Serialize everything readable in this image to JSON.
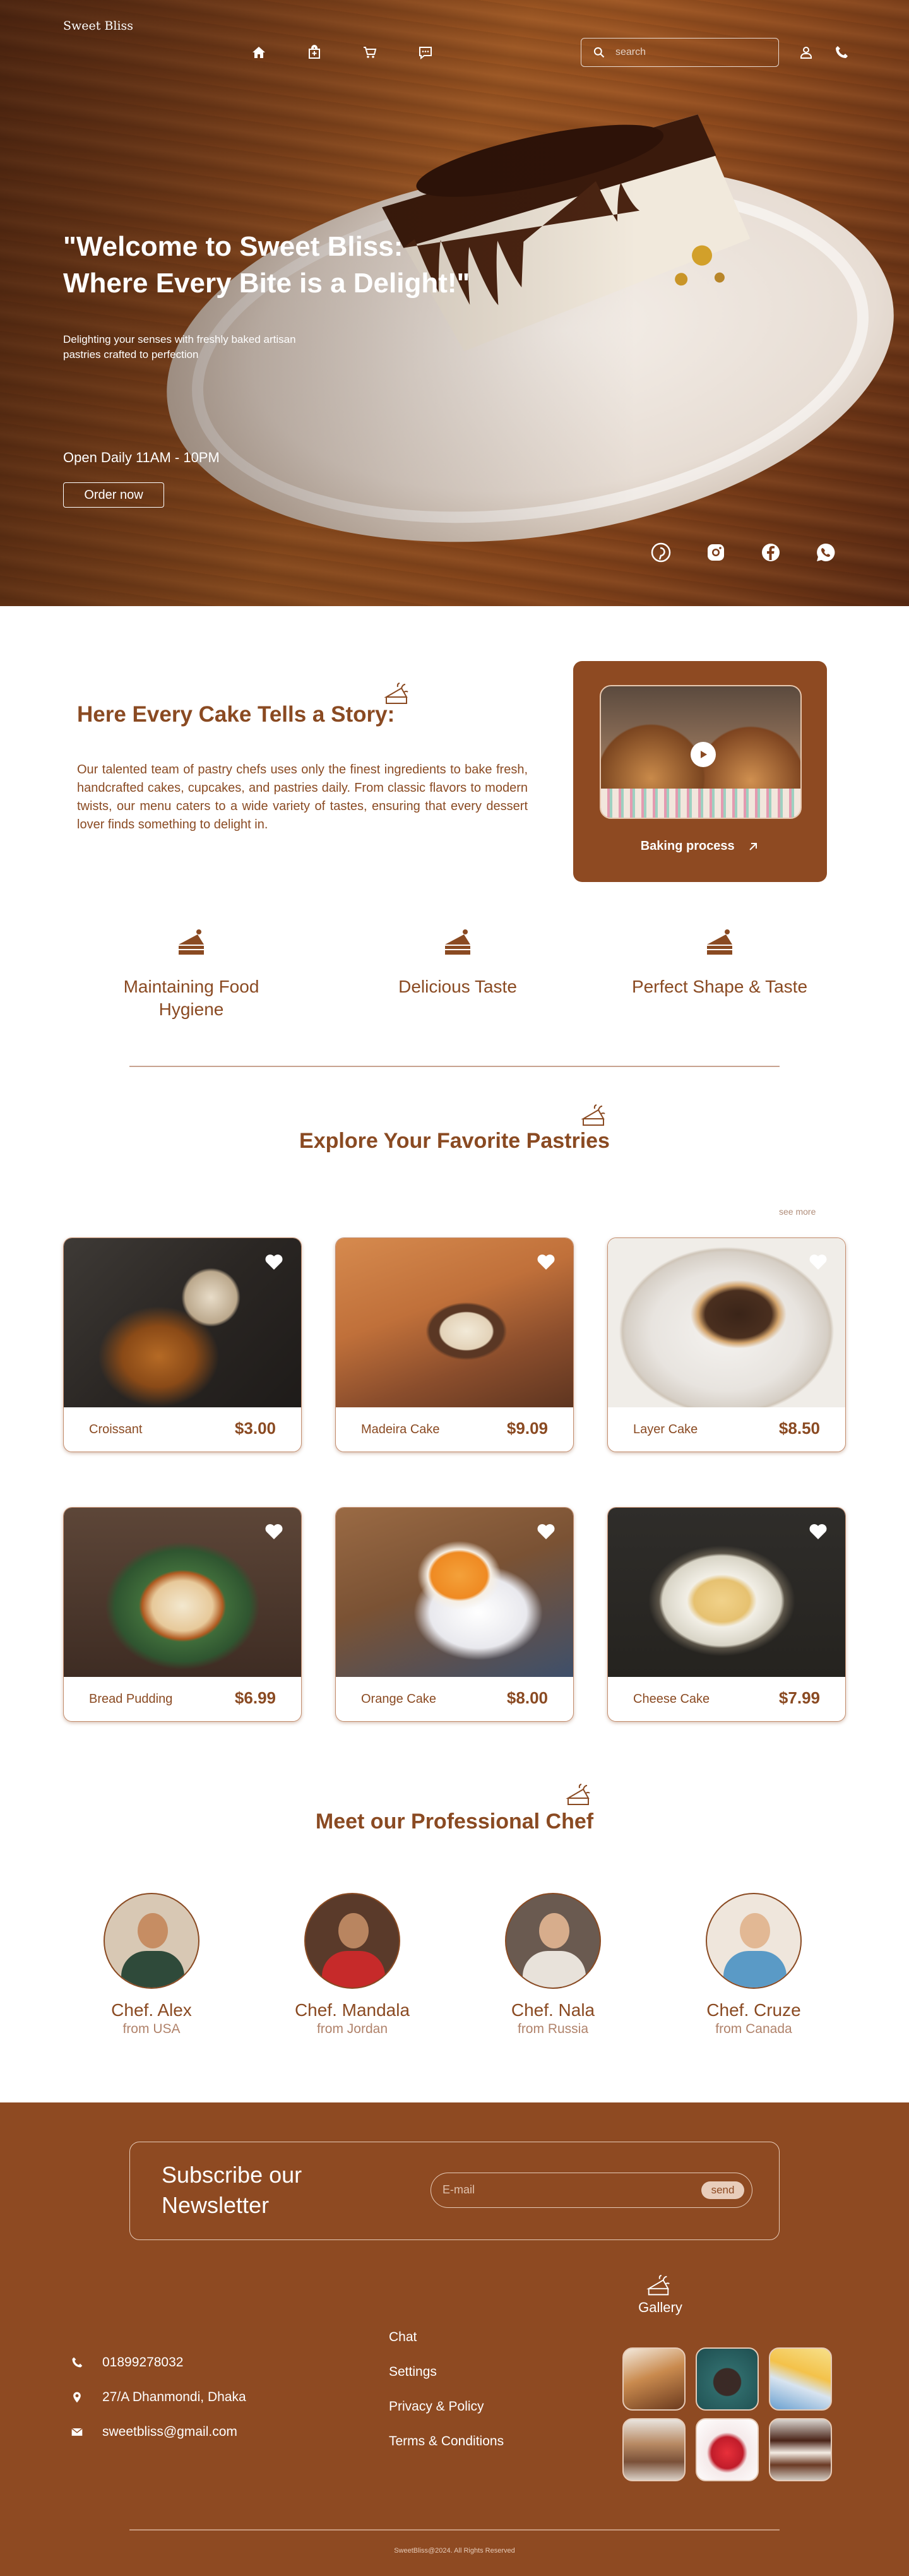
{
  "nav": {
    "logo": "Sweet Bliss",
    "icons": [
      "home-icon",
      "shopping-bag-icon",
      "cart-icon",
      "chat-icon"
    ],
    "search_placeholder": "search",
    "right_icons": [
      "user-icon",
      "phone-icon"
    ]
  },
  "hero": {
    "title_line1": "\"Welcome to Sweet Bliss:",
    "title_line2": "Where Every Bite is a Delight!\"",
    "subtitle": "Delighting your senses with freshly baked artisan pastries crafted to perfection",
    "hours": "Open Daily 11AM - 10PM",
    "order_button": "Order now",
    "socials": [
      "pinterest-icon",
      "instagram-icon",
      "facebook-icon",
      "whatsapp-icon"
    ]
  },
  "story": {
    "title": "Here Every Cake Tells a Story:",
    "text": "Our talented team of pastry chefs uses only the finest ingredients to bake fresh, handcrafted cakes, cupcakes, and pastries daily. From classic flavors to modern twists, our menu caters to a wide variety of tastes, ensuring that every dessert lover finds something to delight in.",
    "video_label": "Baking process"
  },
  "features": [
    {
      "label": "Maintaining Food Hygiene"
    },
    {
      "label": "Delicious Taste"
    },
    {
      "label": "Perfect Shape & Taste"
    }
  ],
  "pastries": {
    "title": "Explore Your Favorite Pastries",
    "see_more": "see more",
    "items": [
      {
        "name": "Croissant",
        "price": "$3.00"
      },
      {
        "name": "Madeira Cake",
        "price": "$9.09"
      },
      {
        "name": "Layer Cake",
        "price": "$8.50"
      },
      {
        "name": "Bread Pudding",
        "price": "$6.99"
      },
      {
        "name": "Orange Cake",
        "price": "$8.00"
      },
      {
        "name": "Cheese Cake",
        "price": "$7.99"
      }
    ]
  },
  "chefs": {
    "title": "Meet our Professional Chef",
    "items": [
      {
        "name": "Chef. Alex",
        "from": "from USA"
      },
      {
        "name": "Chef. Mandala",
        "from": "from Jordan"
      },
      {
        "name": "Chef. Nala",
        "from": "from Russia"
      },
      {
        "name": "Chef. Cruze",
        "from": "from Canada"
      }
    ]
  },
  "footer": {
    "newsletter_title": "Subscribe our Newsletter",
    "email_placeholder": "E-mail",
    "send_label": "send",
    "phone": "01899278032",
    "address": "27/A Dhanmondi, Dhaka",
    "email": "sweetbliss@gmail.com",
    "links": [
      "Chat",
      "Settings",
      "Privacy & Policy",
      "Terms & Conditions"
    ],
    "gallery_title": "Gallery",
    "copyright": "SweetBliss@2024. All Rights Reserved"
  },
  "colors": {
    "brand": "#8e4a22",
    "text": "#8a4a22",
    "light": "#e6cbb8"
  }
}
